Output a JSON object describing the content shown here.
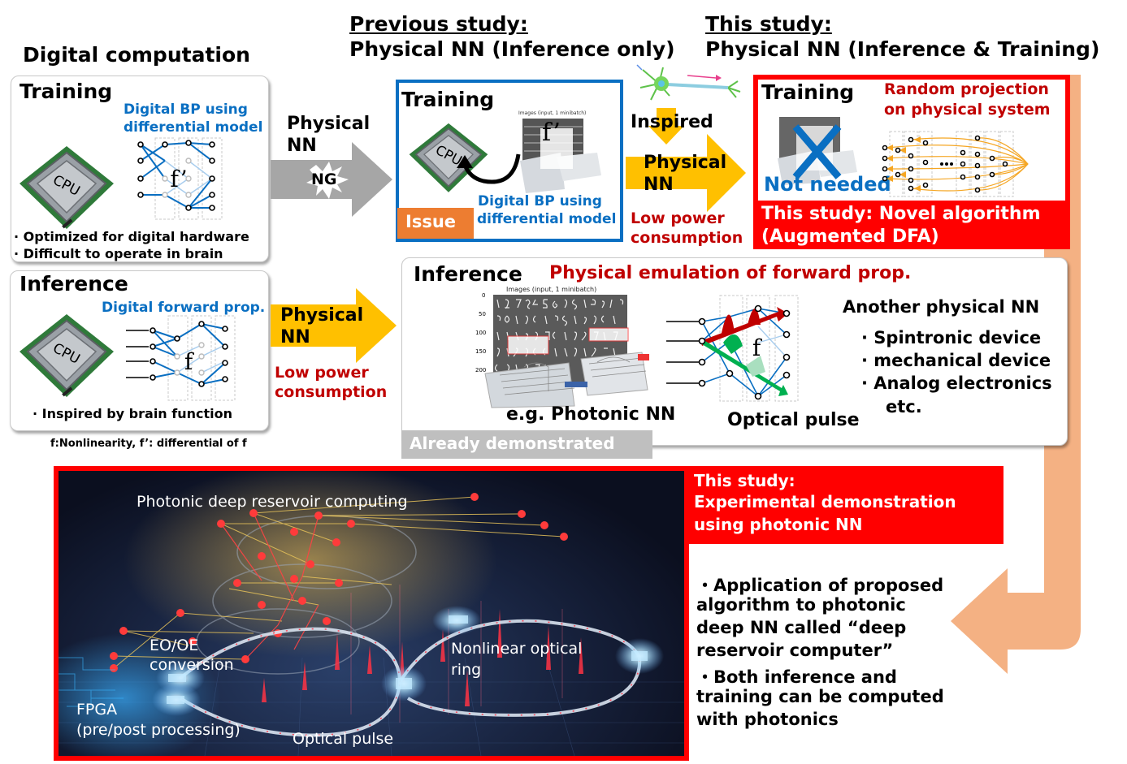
{
  "colors": {
    "blue_text": "#0a6fc2",
    "red_text": "#c00000",
    "accent_red": "#ff0000",
    "arrow_gold": "#ffc000",
    "arrow_gray": "#a6a6a6",
    "issue_orange": "#ed7d31",
    "peach_arrow": "#f4b183",
    "prev_study_border": "#0a6fc2",
    "demonstrated_gray": "#bfbfbf"
  },
  "headers": {
    "digital": "Digital computation",
    "previous_label": "Previous study:",
    "previous_title": "Physical NN (Inference only)",
    "this_label": "This study:",
    "this_title": "Physical NN (Inference & Training)"
  },
  "digital_training": {
    "title": "Training",
    "caption_line1": "Digital BP using",
    "caption_line2": "differential model",
    "cpu_label": "CPU",
    "nn_symbol": "f’",
    "bullets": [
      "· Optimized for digital hardware",
      "· Difficult to operate in brain"
    ]
  },
  "digital_inference": {
    "title": "Inference",
    "caption": "Digital forward prop.",
    "cpu_label": "CPU",
    "nn_symbol": "f",
    "bullets": [
      "· Inspired by brain function"
    ]
  },
  "footnote": "f:Nonlinearity, f’: differential of f",
  "arrow_ng": {
    "label_line1": "Physical",
    "label_line2": "NN",
    "badge": "NG"
  },
  "arrow_inference": {
    "label_line1": "Physical",
    "label_line2": "NN",
    "note_line1": "Low power",
    "note_line2": "consumption"
  },
  "previous_training": {
    "title": "Training",
    "cpu_label": "CPU",
    "nn_symbol": "f’",
    "chart_caption": "Images (input, 1 minibatch)",
    "caption_line1": "Digital BP using",
    "caption_line2": "differential model",
    "issue_badge": "Issue"
  },
  "inspired_arrow": {
    "inspired": "Inspired",
    "label_line1": "Physical",
    "label_line2": "NN",
    "note_line1": "Low power",
    "note_line2": "consumption"
  },
  "this_training": {
    "title": "Training",
    "not_needed": "Not needed",
    "projection_line1": "Random projection",
    "projection_line2": "on physical system",
    "banner_line1": "This study: Novel algorithm",
    "banner_line2": "(Augmented DFA)"
  },
  "inference_panel": {
    "title": "Inference",
    "subtitle": "Physical emulation of forward prop.",
    "chart_caption": "Images (input, 1 minibatch)",
    "y_ticks": [
      "0",
      "50",
      "100",
      "150",
      "200"
    ],
    "photonic_caption": "e.g. Photonic NN",
    "pulse_caption": "Optical pulse",
    "nn_symbol": "f",
    "another_title": "Another physical NN",
    "another_items": [
      "· Spintronic device",
      "· mechanical device",
      "· Analog electronics"
    ],
    "another_etc": "etc.",
    "demonstrated_badge": "Already demonstrated"
  },
  "photo_panel": {
    "labels": {
      "reservoir": "Photonic deep reservoir computing",
      "eo_line1": "EO/OE",
      "eo_line2": "conversion",
      "ring_line1": "Nonlinear optical",
      "ring_line2": "ring",
      "fpga_line1": "FPGA",
      "fpga_line2": "(pre/post processing)",
      "pulse": "Optical pulse"
    }
  },
  "demo_panel": {
    "banner_line1": "This study:",
    "banner_line2": "Experimental demonstration",
    "banner_line3": "using photonic NN",
    "bullets": [
      "・Application of proposed",
      "algorithm to photonic",
      "deep NN called “deep",
      "reservoir computer”",
      "・Both inference and",
      "training can be computed",
      "with photonics"
    ]
  }
}
